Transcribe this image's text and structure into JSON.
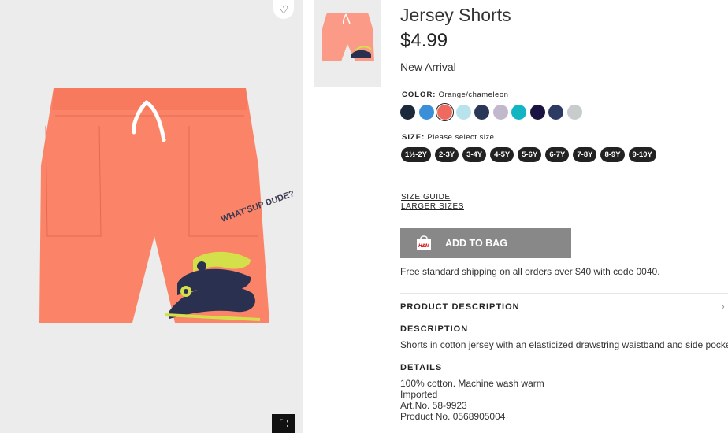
{
  "product": {
    "title": "Jersey Shorts",
    "price": "$4.99",
    "badge": "New Arrival",
    "print_text": "WHAT'SUP DUDE?"
  },
  "gallery": {
    "favorite_icon": "heart-icon",
    "expand_icon": "fullscreen-icon",
    "heart_glyph": "♡",
    "expand_glyph": "⛶"
  },
  "color": {
    "label": "COLOR:",
    "selected": "Orange/chameleon",
    "swatches": [
      "#1a2a3a",
      "#3a8fd8",
      "#f0695f",
      "#b9e3ec",
      "#2a3858",
      "#c2b8cd",
      "#14b5c2",
      "#1a1240",
      "#2c3a64",
      "#c8cccc"
    ]
  },
  "size": {
    "label": "SIZE:",
    "hint": "Please select size",
    "options": [
      "1½-2Y",
      "2-3Y",
      "3-4Y",
      "4-5Y",
      "5-6Y",
      "6-7Y",
      "7-8Y",
      "8-9Y",
      "9-10Y"
    ]
  },
  "links": {
    "size_guide": "SIZE GUIDE",
    "larger_sizes": "LARGER SIZES"
  },
  "bag": {
    "label": "ADD TO BAG",
    "icon_text": "H&M"
  },
  "shipping": "Free standard shipping on all orders over $40 with code 0040.",
  "description": {
    "section_title": "PRODUCT DESCRIPTION",
    "heading": "DESCRIPTION",
    "text": "Shorts in cotton jersey with an elasticized drawstring waistband and side pockets.",
    "details_heading": "DETAILS",
    "details": [
      "100% cotton. Machine wash warm",
      "Imported",
      "Art.No. 58-9923",
      "Product No. 0568905004"
    ]
  }
}
